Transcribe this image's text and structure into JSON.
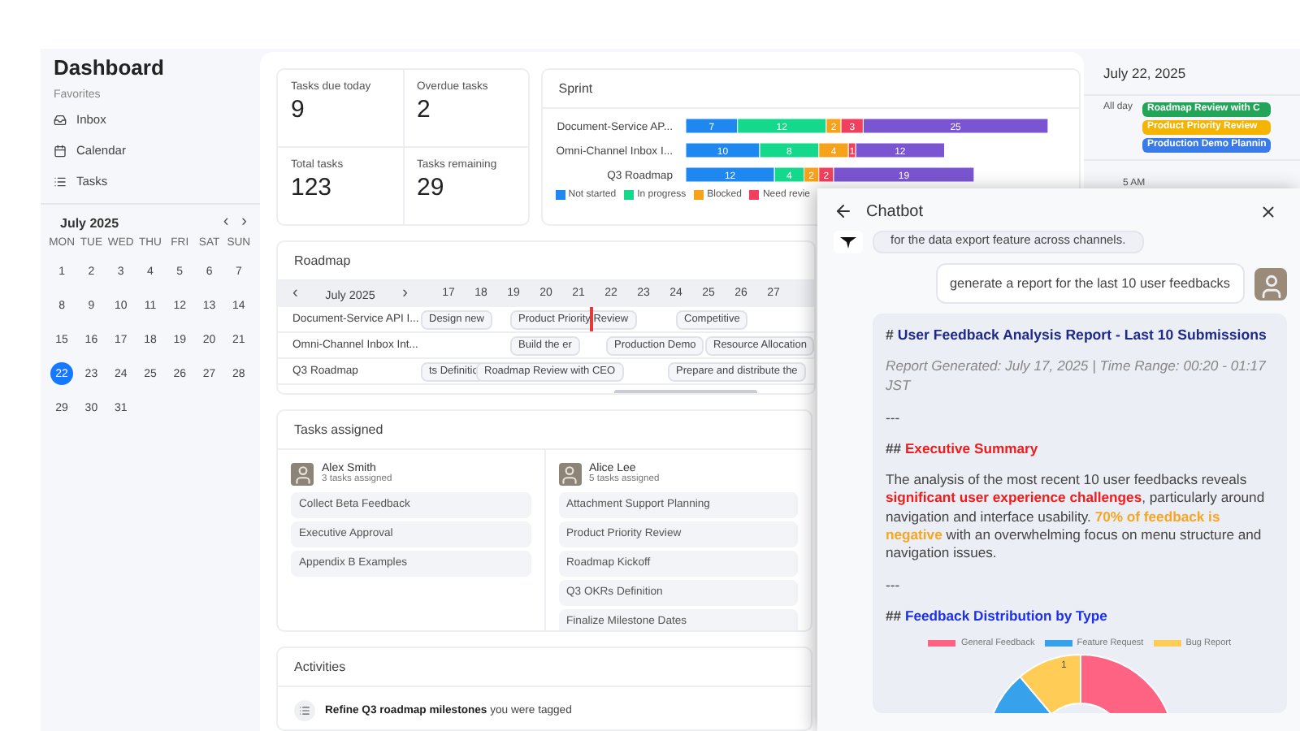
{
  "sidebar": {
    "title": "Dashboard",
    "section": "Favorites",
    "items": [
      {
        "kind": "inbox",
        "label": "Inbox"
      },
      {
        "kind": "calendar",
        "label": "Calendar"
      },
      {
        "kind": "tasks",
        "label": "Tasks"
      }
    ]
  },
  "mini_calendar": {
    "month": "July 2025",
    "prev": "‹",
    "next": "›",
    "weekdays": [
      "MON",
      "TUE",
      "WED",
      "THU",
      "FRI",
      "SAT",
      "SUN"
    ],
    "days": [
      {
        "label": "1",
        "selected": false
      },
      {
        "label": "2",
        "selected": false
      },
      {
        "label": "3",
        "selected": false
      },
      {
        "label": "4",
        "selected": false
      },
      {
        "label": "5",
        "selected": false
      },
      {
        "label": "6",
        "selected": false
      },
      {
        "label": "7",
        "selected": false
      },
      {
        "label": "8",
        "selected": false
      },
      {
        "label": "9",
        "selected": false
      },
      {
        "label": "10",
        "selected": false
      },
      {
        "label": "11",
        "selected": false
      },
      {
        "label": "12",
        "selected": false
      },
      {
        "label": "13",
        "selected": false
      },
      {
        "label": "14",
        "selected": false
      },
      {
        "label": "15",
        "selected": false
      },
      {
        "label": "16",
        "selected": false
      },
      {
        "label": "17",
        "selected": false
      },
      {
        "label": "18",
        "selected": false
      },
      {
        "label": "19",
        "selected": false
      },
      {
        "label": "20",
        "selected": false
      },
      {
        "label": "21",
        "selected": false
      },
      {
        "label": "22",
        "selected": true
      },
      {
        "label": "23",
        "selected": false
      },
      {
        "label": "24",
        "selected": false
      },
      {
        "label": "25",
        "selected": false
      },
      {
        "label": "26",
        "selected": false
      },
      {
        "label": "27",
        "selected": false
      },
      {
        "label": "28",
        "selected": false
      },
      {
        "label": "29",
        "selected": false
      },
      {
        "label": "30",
        "selected": false
      },
      {
        "label": "31",
        "selected": false
      }
    ]
  },
  "stats": [
    {
      "label": "Tasks due today",
      "value": "9"
    },
    {
      "label": "Overdue tasks",
      "value": "2"
    },
    {
      "label": "Total tasks",
      "value": "123"
    },
    {
      "label": "Tasks remaining",
      "value": "29"
    }
  ],
  "sprint": {
    "title": "Sprint",
    "chart_data": {
      "type": "bar",
      "orientation": "horizontal",
      "stacked": true,
      "data_labels": true,
      "categories": [
        "Document-Service AP...",
        "Omni-Channel Inbox I...",
        "Q3 Roadmap"
      ],
      "series": [
        {
          "name": "Not started",
          "color": "#1e88f0",
          "values": [
            7,
            10,
            12
          ]
        },
        {
          "name": "In progress",
          "color": "#14d98c",
          "values": [
            12,
            8,
            4
          ]
        },
        {
          "name": "Blocked",
          "color": "#f7a21b",
          "values": [
            2,
            4,
            2
          ]
        },
        {
          "name": "Need revie",
          "color": "#f0405e",
          "values": [
            3,
            1,
            2
          ]
        },
        {
          "color": "#7b55d1",
          "values": [
            25,
            12,
            19
          ]
        }
      ]
    }
  },
  "roadmap": {
    "title": "Roadmap",
    "prev": "‹",
    "month": "July 2025",
    "next": "›",
    "days": [
      "17",
      "18",
      "19",
      "20",
      "21",
      "22",
      "23",
      "24",
      "25",
      "26",
      "27"
    ],
    "rows": [
      {
        "name": "Document-Service API I...",
        "bars": [
          "Design new",
          "Product Priority Review",
          "Competitive"
        ]
      },
      {
        "name": "Omni-Channel Inbox Int...",
        "bars": [
          "Build the er",
          "Production Demo",
          "Resource Allocation"
        ]
      },
      {
        "name": "Q3 Roadmap",
        "bars": [
          "ts Definitio",
          "Roadmap Review with CEO",
          "Prepare and distribute the"
        ]
      }
    ]
  },
  "tasks_assigned": {
    "title": "Tasks assigned",
    "people": [
      {
        "name": "Alex Smith",
        "count": "3 tasks assigned",
        "tasks": [
          "Collect Beta Feedback",
          "Executive Approval",
          "Appendix B Examples"
        ]
      },
      {
        "name": "Alice Lee",
        "count": "5 tasks assigned",
        "tasks": [
          "Attachment Support Planning",
          "Product Priority Review",
          "Roadmap Kickoff",
          "Q3 OKRs Definition",
          "Finalize Milestone Dates"
        ]
      }
    ]
  },
  "activities": {
    "title": "Activities",
    "items": [
      {
        "text": "**Refine Q3 roadmap milestones** you were tagged"
      }
    ]
  },
  "day_view": {
    "date": "July 22, 2025",
    "all_day_label": "All day",
    "events": [
      {
        "title": "Roadmap Review with C",
        "color": "#22a559"
      },
      {
        "title": "Product Priority Review",
        "color": "#f5b400"
      },
      {
        "title": "Production Demo Plannin",
        "color": "#3a7bea"
      }
    ],
    "hours": [
      "5 AM"
    ]
  },
  "chatbot": {
    "title": "Chatbot",
    "messages": [
      {
        "kind": "bot",
        "text": "for the data export feature across channels."
      },
      {
        "kind": "user",
        "text": "generate a report for the last 10 user feedbacks"
      }
    ],
    "report": [
      {
        "kind": "h1",
        "marker": "#",
        "text": "User Feedback Analysis Report - Last 10 Submissions",
        "color": "#1d2a8a"
      },
      {
        "kind": "meta",
        "text": "Report Generated: July 17, 2025 | Time Range: 00:20 - 01:17 JST"
      },
      {
        "kind": "rule",
        "text": "---"
      },
      {
        "kind": "h2",
        "marker": "##",
        "text": "Executive Summary",
        "color": "#f01c1c"
      },
      {
        "kind": "para",
        "segments": [
          {
            "text": "The analysis of the most recent 10 user feedbacks reveals "
          },
          {
            "text": "significant user experience challenges",
            "color": "#f01c1c"
          },
          {
            "text": ", particularly around navigation and interface usability. "
          },
          {
            "text": "70% of feedback is negative",
            "color": "#f5a623"
          },
          {
            "text": " with an overwhelming focus on menu structure and navigation issues."
          }
        ]
      },
      {
        "kind": "rule",
        "text": "---"
      },
      {
        "kind": "h2",
        "marker": "##",
        "text": "Feedback Distribution by Type",
        "color": "#1b2ff0"
      },
      {
        "kind": "chart",
        "legend": [
          {
            "label": "General Feedback",
            "color": "#ff6384"
          },
          {
            "label": "Feature Request",
            "color": "#36a2eb"
          },
          {
            "label": "Bug Report",
            "color": "#ffcd56"
          }
        ],
        "slice_label": "1"
      }
    ]
  }
}
